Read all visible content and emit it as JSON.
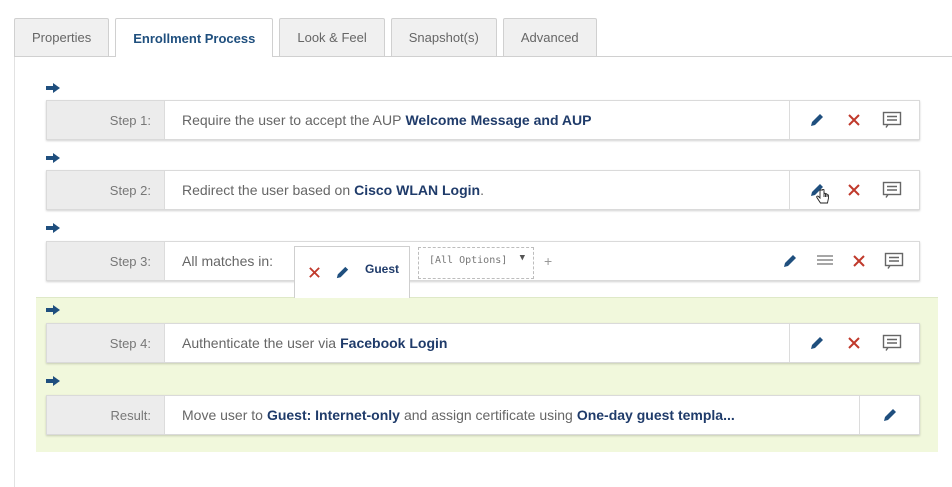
{
  "tabs": [
    {
      "label": "Properties",
      "active": false
    },
    {
      "label": "Enrollment Process",
      "active": true
    },
    {
      "label": "Look & Feel",
      "active": false
    },
    {
      "label": "Snapshot(s)",
      "active": false
    },
    {
      "label": "Advanced",
      "active": false
    }
  ],
  "steps": [
    {
      "label": "Step 1:",
      "text": "Require the user to accept the AUP",
      "bold": "Welcome Message and AUP",
      "after": ""
    },
    {
      "label": "Step 2:",
      "text": "Redirect the user based on",
      "bold": "Cisco WLAN Login",
      "after": "."
    },
    {
      "label": "Step 3:",
      "text": "All matches in:",
      "guest_label": "Guest",
      "options_placeholder": "[All Options]",
      "add_symbol": "+"
    },
    {
      "label": "Step 4:",
      "text": "Authenticate the user via",
      "bold": "Facebook Login",
      "after": ""
    }
  ],
  "result": {
    "label": "Result:",
    "text": "Move user to",
    "bold1": "Guest: Internet-only",
    "middle": "and assign certificate using",
    "bold2": "One-day guest templa..."
  },
  "colors": {
    "accent": "#1f4f7e",
    "delete": "#c0392b",
    "highlight": "#f1f8dc"
  },
  "icons": [
    "arrow-right-icon",
    "pencil-icon",
    "close-icon",
    "comment-icon",
    "menu-icon",
    "hand-pointer-icon"
  ]
}
